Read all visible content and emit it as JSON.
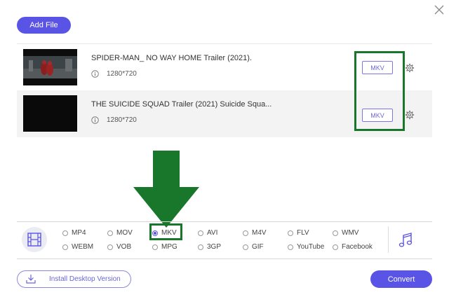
{
  "toolbar": {
    "add_file_label": "Add File"
  },
  "files": [
    {
      "name": "SPIDER-MAN_ NO WAY HOME Trailer (2021).",
      "resolution": "1280*720",
      "format": "MKV"
    },
    {
      "name": "THE SUICIDE SQUAD Trailer (2021) Suicide Squa...",
      "resolution": "1280*720",
      "format": "MKV"
    }
  ],
  "formats": {
    "row1": [
      "MP4",
      "MOV",
      "MKV",
      "AVI",
      "M4V",
      "FLV",
      "WMV"
    ],
    "row2": [
      "WEBM",
      "VOB",
      "MPG",
      "3GP",
      "GIF",
      "YouTube",
      "Facebook"
    ],
    "selected": "MKV"
  },
  "footer": {
    "install_label": "Install Desktop Version",
    "convert_label": "Convert"
  },
  "colors": {
    "accent": "#5a54e6",
    "highlight": "#19772b"
  }
}
